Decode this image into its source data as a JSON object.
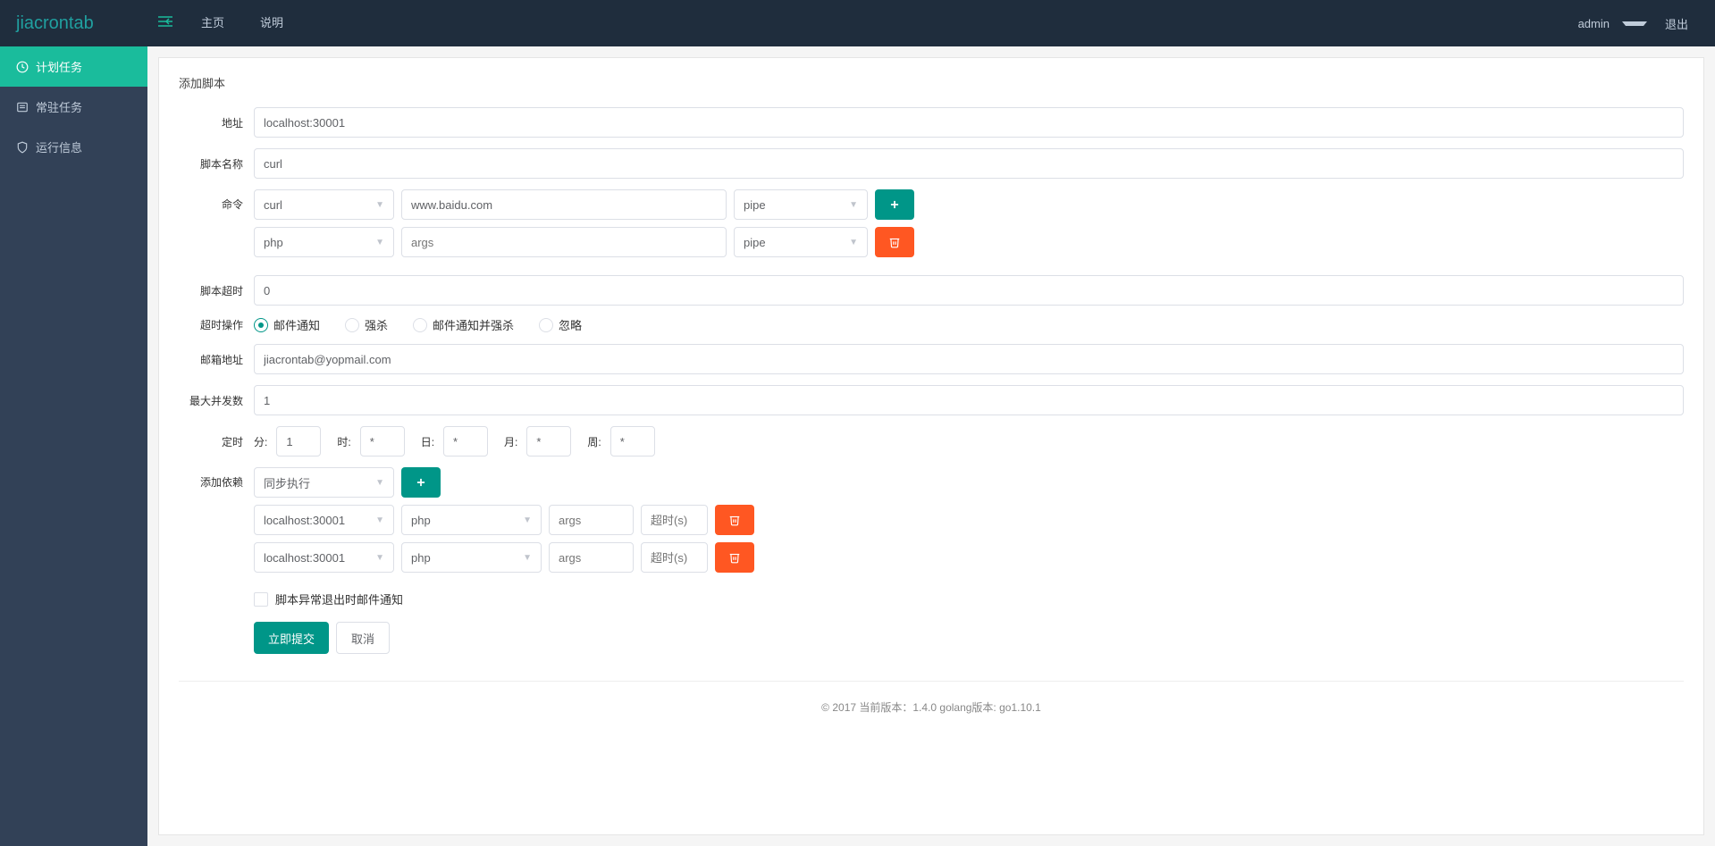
{
  "header": {
    "logo": "jiacrontab",
    "nav": [
      "主页",
      "说明"
    ],
    "user": "admin",
    "logout": "退出"
  },
  "sidebar": {
    "items": [
      {
        "label": "计划任务",
        "icon": "clock"
      },
      {
        "label": "常驻任务",
        "icon": "list"
      },
      {
        "label": "运行信息",
        "icon": "shield"
      }
    ]
  },
  "form": {
    "title": "添加脚本",
    "labels": {
      "address": "地址",
      "script_name": "脚本名称",
      "command": "命令",
      "timeout": "脚本超时",
      "timeout_action": "超时操作",
      "email": "邮箱地址",
      "max_concurrent": "最大并发数",
      "cron": "定时",
      "dependency": "添加依赖"
    },
    "address": "localhost:30001",
    "script_name": "curl",
    "commands": [
      {
        "runner": "curl",
        "args": "www.baidu.com",
        "pipe": "pipe",
        "action": "add"
      },
      {
        "runner": "php",
        "args": "",
        "args_placeholder": "args",
        "pipe": "pipe",
        "action": "del"
      }
    ],
    "timeout": "0",
    "timeout_options": [
      "邮件通知",
      "强杀",
      "邮件通知并强杀",
      "忽略"
    ],
    "timeout_selected": 0,
    "email": "jiacrontab@yopmail.com",
    "max_concurrent": "1",
    "cron": {
      "min_label": "分:",
      "min": "1",
      "hour_label": "时:",
      "hour": "*",
      "day_label": "日:",
      "day": "*",
      "month_label": "月:",
      "month": "*",
      "week_label": "周:",
      "week": "*"
    },
    "dependency_mode": "同步执行",
    "dependencies": [
      {
        "addr": "localhost:30001",
        "runner": "php",
        "args_placeholder": "args",
        "timeout_placeholder": "超时(s)"
      },
      {
        "addr": "localhost:30001",
        "runner": "php",
        "args_placeholder": "args",
        "timeout_placeholder": "超时(s)"
      }
    ],
    "notify_checkbox": "脚本异常退出时邮件通知",
    "submit": "立即提交",
    "cancel": "取消"
  },
  "footer": "© 2017 当前版本：1.4.0 golang版本: go1.10.1"
}
